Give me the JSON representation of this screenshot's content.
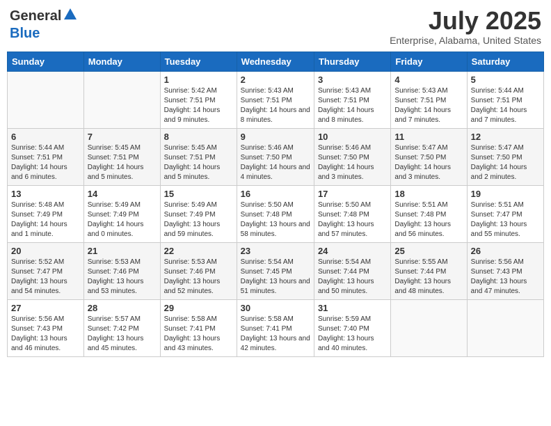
{
  "header": {
    "logo_general": "General",
    "logo_blue": "Blue",
    "month_title": "July 2025",
    "location": "Enterprise, Alabama, United States"
  },
  "weekdays": [
    "Sunday",
    "Monday",
    "Tuesday",
    "Wednesday",
    "Thursday",
    "Friday",
    "Saturday"
  ],
  "weeks": [
    [
      {
        "day": "",
        "sunrise": "",
        "sunset": "",
        "daylight": ""
      },
      {
        "day": "",
        "sunrise": "",
        "sunset": "",
        "daylight": ""
      },
      {
        "day": "1",
        "sunrise": "Sunrise: 5:42 AM",
        "sunset": "Sunset: 7:51 PM",
        "daylight": "Daylight: 14 hours and 9 minutes."
      },
      {
        "day": "2",
        "sunrise": "Sunrise: 5:43 AM",
        "sunset": "Sunset: 7:51 PM",
        "daylight": "Daylight: 14 hours and 8 minutes."
      },
      {
        "day": "3",
        "sunrise": "Sunrise: 5:43 AM",
        "sunset": "Sunset: 7:51 PM",
        "daylight": "Daylight: 14 hours and 8 minutes."
      },
      {
        "day": "4",
        "sunrise": "Sunrise: 5:43 AM",
        "sunset": "Sunset: 7:51 PM",
        "daylight": "Daylight: 14 hours and 7 minutes."
      },
      {
        "day": "5",
        "sunrise": "Sunrise: 5:44 AM",
        "sunset": "Sunset: 7:51 PM",
        "daylight": "Daylight: 14 hours and 7 minutes."
      }
    ],
    [
      {
        "day": "6",
        "sunrise": "Sunrise: 5:44 AM",
        "sunset": "Sunset: 7:51 PM",
        "daylight": "Daylight: 14 hours and 6 minutes."
      },
      {
        "day": "7",
        "sunrise": "Sunrise: 5:45 AM",
        "sunset": "Sunset: 7:51 PM",
        "daylight": "Daylight: 14 hours and 5 minutes."
      },
      {
        "day": "8",
        "sunrise": "Sunrise: 5:45 AM",
        "sunset": "Sunset: 7:51 PM",
        "daylight": "Daylight: 14 hours and 5 minutes."
      },
      {
        "day": "9",
        "sunrise": "Sunrise: 5:46 AM",
        "sunset": "Sunset: 7:50 PM",
        "daylight": "Daylight: 14 hours and 4 minutes."
      },
      {
        "day": "10",
        "sunrise": "Sunrise: 5:46 AM",
        "sunset": "Sunset: 7:50 PM",
        "daylight": "Daylight: 14 hours and 3 minutes."
      },
      {
        "day": "11",
        "sunrise": "Sunrise: 5:47 AM",
        "sunset": "Sunset: 7:50 PM",
        "daylight": "Daylight: 14 hours and 3 minutes."
      },
      {
        "day": "12",
        "sunrise": "Sunrise: 5:47 AM",
        "sunset": "Sunset: 7:50 PM",
        "daylight": "Daylight: 14 hours and 2 minutes."
      }
    ],
    [
      {
        "day": "13",
        "sunrise": "Sunrise: 5:48 AM",
        "sunset": "Sunset: 7:49 PM",
        "daylight": "Daylight: 14 hours and 1 minute."
      },
      {
        "day": "14",
        "sunrise": "Sunrise: 5:49 AM",
        "sunset": "Sunset: 7:49 PM",
        "daylight": "Daylight: 14 hours and 0 minutes."
      },
      {
        "day": "15",
        "sunrise": "Sunrise: 5:49 AM",
        "sunset": "Sunset: 7:49 PM",
        "daylight": "Daylight: 13 hours and 59 minutes."
      },
      {
        "day": "16",
        "sunrise": "Sunrise: 5:50 AM",
        "sunset": "Sunset: 7:48 PM",
        "daylight": "Daylight: 13 hours and 58 minutes."
      },
      {
        "day": "17",
        "sunrise": "Sunrise: 5:50 AM",
        "sunset": "Sunset: 7:48 PM",
        "daylight": "Daylight: 13 hours and 57 minutes."
      },
      {
        "day": "18",
        "sunrise": "Sunrise: 5:51 AM",
        "sunset": "Sunset: 7:48 PM",
        "daylight": "Daylight: 13 hours and 56 minutes."
      },
      {
        "day": "19",
        "sunrise": "Sunrise: 5:51 AM",
        "sunset": "Sunset: 7:47 PM",
        "daylight": "Daylight: 13 hours and 55 minutes."
      }
    ],
    [
      {
        "day": "20",
        "sunrise": "Sunrise: 5:52 AM",
        "sunset": "Sunset: 7:47 PM",
        "daylight": "Daylight: 13 hours and 54 minutes."
      },
      {
        "day": "21",
        "sunrise": "Sunrise: 5:53 AM",
        "sunset": "Sunset: 7:46 PM",
        "daylight": "Daylight: 13 hours and 53 minutes."
      },
      {
        "day": "22",
        "sunrise": "Sunrise: 5:53 AM",
        "sunset": "Sunset: 7:46 PM",
        "daylight": "Daylight: 13 hours and 52 minutes."
      },
      {
        "day": "23",
        "sunrise": "Sunrise: 5:54 AM",
        "sunset": "Sunset: 7:45 PM",
        "daylight": "Daylight: 13 hours and 51 minutes."
      },
      {
        "day": "24",
        "sunrise": "Sunrise: 5:54 AM",
        "sunset": "Sunset: 7:44 PM",
        "daylight": "Daylight: 13 hours and 50 minutes."
      },
      {
        "day": "25",
        "sunrise": "Sunrise: 5:55 AM",
        "sunset": "Sunset: 7:44 PM",
        "daylight": "Daylight: 13 hours and 48 minutes."
      },
      {
        "day": "26",
        "sunrise": "Sunrise: 5:56 AM",
        "sunset": "Sunset: 7:43 PM",
        "daylight": "Daylight: 13 hours and 47 minutes."
      }
    ],
    [
      {
        "day": "27",
        "sunrise": "Sunrise: 5:56 AM",
        "sunset": "Sunset: 7:43 PM",
        "daylight": "Daylight: 13 hours and 46 minutes."
      },
      {
        "day": "28",
        "sunrise": "Sunrise: 5:57 AM",
        "sunset": "Sunset: 7:42 PM",
        "daylight": "Daylight: 13 hours and 45 minutes."
      },
      {
        "day": "29",
        "sunrise": "Sunrise: 5:58 AM",
        "sunset": "Sunset: 7:41 PM",
        "daylight": "Daylight: 13 hours and 43 minutes."
      },
      {
        "day": "30",
        "sunrise": "Sunrise: 5:58 AM",
        "sunset": "Sunset: 7:41 PM",
        "daylight": "Daylight: 13 hours and 42 minutes."
      },
      {
        "day": "31",
        "sunrise": "Sunrise: 5:59 AM",
        "sunset": "Sunset: 7:40 PM",
        "daylight": "Daylight: 13 hours and 40 minutes."
      },
      {
        "day": "",
        "sunrise": "",
        "sunset": "",
        "daylight": ""
      },
      {
        "day": "",
        "sunrise": "",
        "sunset": "",
        "daylight": ""
      }
    ]
  ]
}
